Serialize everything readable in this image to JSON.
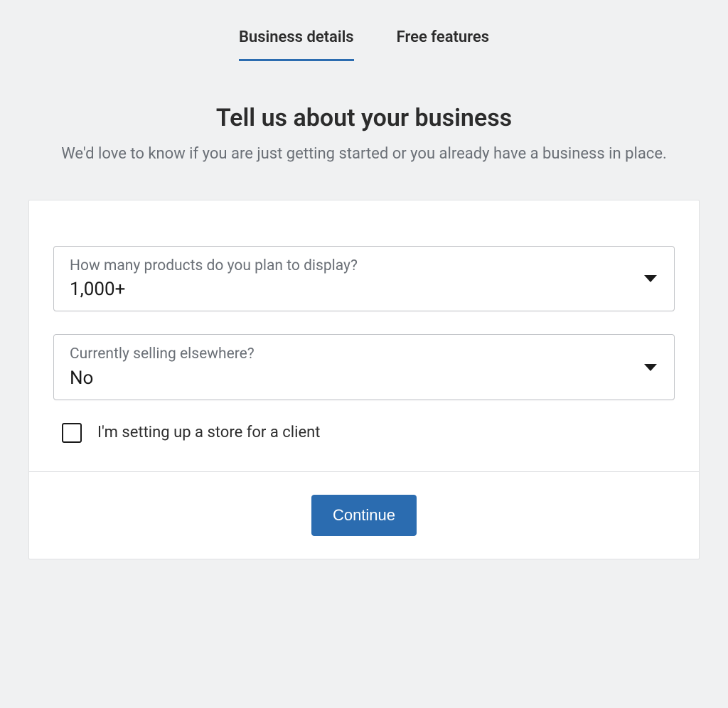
{
  "tabs": {
    "business_details": "Business details",
    "free_features": "Free features"
  },
  "header": {
    "title": "Tell us about your business",
    "subtitle": "We'd love to know if you are just getting started or you already have a business in place."
  },
  "form": {
    "products": {
      "label": "How many products do you plan to display?",
      "value": "1,000+"
    },
    "selling_elsewhere": {
      "label": "Currently selling elsewhere?",
      "value": "No"
    },
    "client_checkbox": {
      "label": "I'm setting up a store for a client",
      "checked": false
    }
  },
  "footer": {
    "continue_label": "Continue"
  }
}
